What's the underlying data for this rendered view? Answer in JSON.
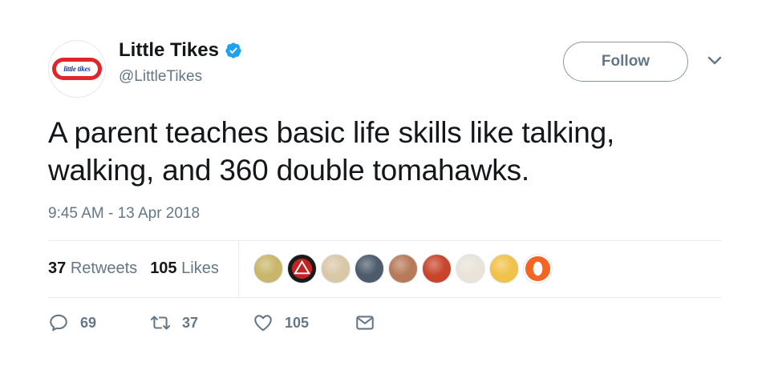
{
  "account": {
    "display_name": "Little Tikes",
    "handle": "@LittleTikes",
    "logo_text": "little tikes",
    "verified_icon": "verified-badge-icon",
    "verified_color": "#1da1f2"
  },
  "header": {
    "follow_label": "Follow",
    "menu_icon": "chevron-down-icon"
  },
  "tweet": {
    "text": "A parent teaches basic life skills like talking, walking, and 360 double tomahawks.",
    "timestamp": "9:45 AM - 13 Apr 2018"
  },
  "stats": {
    "retweets_count": "37",
    "retweets_label": "Retweets",
    "likes_count": "105",
    "likes_label": "Likes"
  },
  "likers": [
    {
      "name": "liker-avatar-1",
      "color": "#c9b66a"
    },
    {
      "name": "liker-avatar-2",
      "color": "#c22323"
    },
    {
      "name": "liker-avatar-3",
      "color": "#d9c7a8"
    },
    {
      "name": "liker-avatar-4",
      "color": "#4d5b6b"
    },
    {
      "name": "liker-avatar-5",
      "color": "#b87a5a"
    },
    {
      "name": "liker-avatar-6",
      "color": "#c8452c"
    },
    {
      "name": "liker-avatar-7",
      "color": "#e9e3d8"
    },
    {
      "name": "liker-avatar-8",
      "color": "#f1c24a"
    },
    {
      "name": "liker-avatar-9",
      "color": "#f26522"
    }
  ],
  "actions": {
    "reply_icon": "reply-icon",
    "reply_count": "69",
    "retweet_icon": "retweet-icon",
    "retweet_count": "37",
    "like_icon": "heart-icon",
    "like_count": "105",
    "dm_icon": "envelope-icon"
  },
  "colors": {
    "text_primary": "#14171a",
    "text_secondary": "#657786",
    "accent": "#1da1f2",
    "divider": "#e6ecf0",
    "brand_red": "#e0262b"
  }
}
